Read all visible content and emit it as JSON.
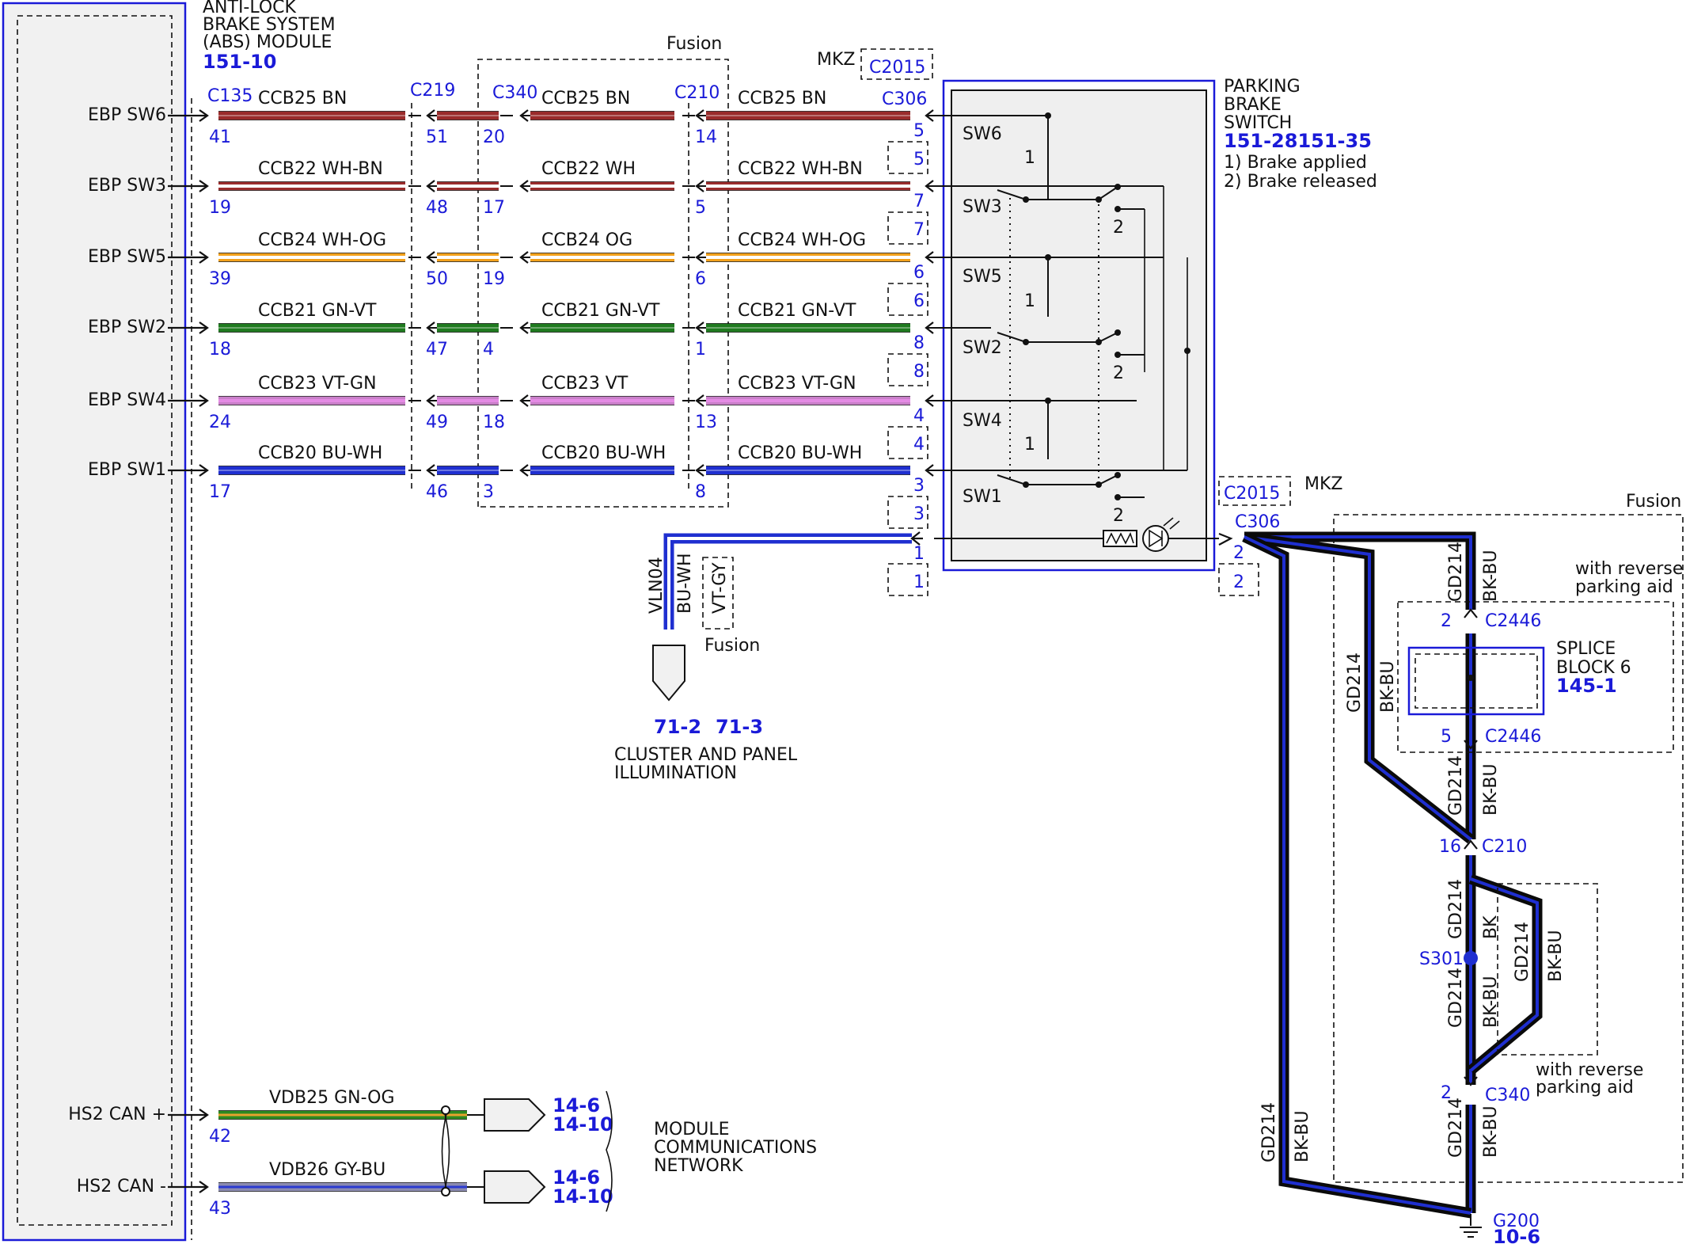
{
  "abs_module": {
    "title_lines": [
      "ANTI-LOCK",
      "BRAKE SYSTEM",
      "(ABS) MODULE"
    ],
    "ref": "151-10",
    "pin_labels": [
      "EBP SW6",
      "EBP SW3",
      "EBP SW5",
      "EBP SW2",
      "EBP SW4",
      "EBP SW1",
      "HS2 CAN +",
      "HS2 CAN -"
    ]
  },
  "connectors": {
    "c135": "C135",
    "c219": "C219",
    "c340": "C340",
    "c210": "C210",
    "c306": "C306",
    "c2015": "C2015",
    "mkz": "MKZ",
    "fusion": "Fusion"
  },
  "circuits": [
    {
      "pin_label": "EBP SW6",
      "circuit": "CCB25",
      "c135_pin": "41",
      "c219_pin": "51",
      "c340_pin": "20",
      "c210_pin": "14",
      "c306_pin": "5",
      "c2015_pin": "5",
      "colors": [
        "BN",
        "BN",
        "BN"
      ],
      "stripe": "#9a2c2c",
      "core": "#9a2c2c"
    },
    {
      "pin_label": "EBP SW3",
      "circuit": "CCB22",
      "c135_pin": "19",
      "c219_pin": "48",
      "c340_pin": "17",
      "c210_pin": "5",
      "c306_pin": "7",
      "c2015_pin": "7",
      "colors": [
        "WH-BN",
        "WH",
        "WH-BN"
      ],
      "stripe": "#9a2c2c",
      "core": "#ffffff"
    },
    {
      "pin_label": "EBP SW5",
      "circuit": "CCB24",
      "c135_pin": "39",
      "c219_pin": "50",
      "c340_pin": "19",
      "c210_pin": "6",
      "c306_pin": "6",
      "c2015_pin": "6",
      "colors": [
        "WH-OG",
        "OG",
        "WH-OG"
      ],
      "stripe": "#f2a11b",
      "core": "#ffffff"
    },
    {
      "pin_label": "EBP SW2",
      "circuit": "CCB21",
      "c135_pin": "18",
      "c219_pin": "47",
      "c340_pin": "4",
      "c210_pin": "1",
      "c306_pin": "8",
      "c2015_pin": "8",
      "colors": [
        "GN-VT",
        "GN-VT",
        "GN-VT"
      ],
      "stripe": "#1f7a1f",
      "core": "#1f7a1f"
    },
    {
      "pin_label": "EBP SW4",
      "circuit": "CCB23",
      "c135_pin": "24",
      "c219_pin": "49",
      "c340_pin": "18",
      "c210_pin": "13",
      "c306_pin": "4",
      "c2015_pin": "4",
      "colors": [
        "VT-GN",
        "VT",
        "VT-GN"
      ],
      "stripe": "#c97fc9",
      "core": "#e58be5"
    },
    {
      "pin_label": "EBP SW1",
      "circuit": "CCB20",
      "c135_pin": "17",
      "c219_pin": "46",
      "c340_pin": "3",
      "c210_pin": "8",
      "c306_pin": "3",
      "c2015_pin": "3",
      "colors": [
        "BU-WH",
        "BU-WH",
        "BU-WH"
      ],
      "stripe": "#1f2fd0",
      "core": "#1f2fd0"
    }
  ],
  "parking_switch": {
    "title_lines": [
      "PARKING",
      "BRAKE",
      "SWITCH"
    ],
    "ref": "151-28151-35",
    "notes": [
      "1) Brake applied",
      "2) Brake released"
    ],
    "switch_labels": [
      "SW6",
      "SW3",
      "SW5",
      "SW2",
      "SW4",
      "SW1"
    ],
    "pos1": "1",
    "pos2": "2"
  },
  "illumination": {
    "circuit": "VLN04",
    "color1": "BU-WH",
    "color2": "VT-GY",
    "fusion_label": "Fusion",
    "c306_pin": "1",
    "c2015_pin": "1",
    "refs": [
      "71-2",
      "71-3"
    ],
    "dest_lines": [
      "CLUSTER AND PANEL",
      "ILLUMINATION"
    ]
  },
  "ground": {
    "c2015_label": "C2015",
    "mkz": "MKZ",
    "c306_label": "C306",
    "c306_pin": "2",
    "c2015_pin": "2",
    "fusion_label": "Fusion",
    "circuit": "GD214",
    "color": "BK-BU",
    "color_bk": "BK",
    "with_rpa_1": [
      "with reverse",
      "parking aid"
    ],
    "with_rpa_2": [
      "with reverse",
      "parking aid"
    ],
    "splice_lines": [
      "SPLICE",
      "BLOCK 6"
    ],
    "splice_ref": "145-1",
    "c2446": "C2446",
    "c2446_pin_top": "2",
    "c2446_pin_bottom": "5",
    "c210": "C210",
    "c210_pin": "16",
    "s301": "S301",
    "c340": "C340",
    "c340_pin": "2",
    "g200": "G200",
    "g200_ref": "10-6"
  },
  "can": {
    "lines": [
      {
        "circuit": "VDB25",
        "color": "GN-OG",
        "pin": "42",
        "refs": [
          "14-6",
          "14-10"
        ]
      },
      {
        "circuit": "VDB26",
        "color": "GY-BU",
        "pin": "43",
        "refs": [
          "14-6",
          "14-10"
        ]
      }
    ],
    "dest_lines": [
      "MODULE",
      "COMMUNICATIONS",
      "NETWORK"
    ]
  },
  "colors": {
    "ref_blue": "#1a1ad8",
    "ground_wire": "#0a0a0a",
    "ground_stripe": "#1f2fd0",
    "can_green": "#2e8a22",
    "can_green_stripe": "#e8a32e",
    "can_gray": "#8b8bb0",
    "can_gray_stripe": "#2a3ad0"
  }
}
